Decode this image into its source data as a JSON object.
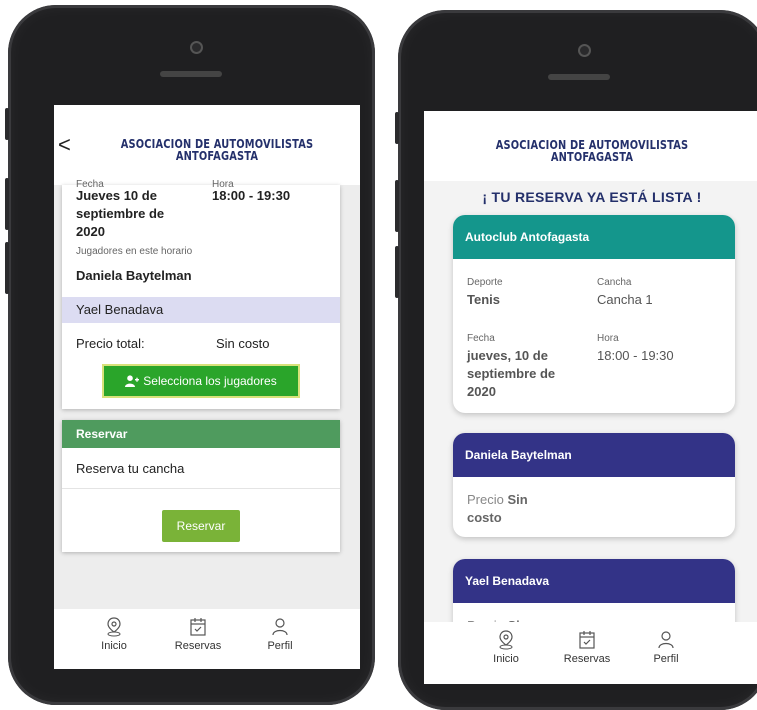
{
  "left": {
    "header": {
      "back_glyph": "<",
      "title_line1": "ASOCIACION  DE  AUTOMOVILISTAS",
      "title_line2": "ANTOFAGASTA"
    },
    "booking": {
      "date_label": "Fecha",
      "time_label": "Hora",
      "date_value": [
        "Jueves 10 de",
        "septiembre de",
        "2020"
      ],
      "time_value": "18:00 - 19:30",
      "players_label": "Jugadores en este horario",
      "player1": "Daniela Baytelman",
      "player2": "Yael Benadava",
      "price_label": "Precio total:",
      "price_value": "Sin costo",
      "select_players_button": "Selecciona los jugadores"
    },
    "reserve_card": {
      "header": "Reservar",
      "text": "Reserva tu cancha",
      "button": "Reservar"
    },
    "nav": [
      {
        "icon": "location-pin-icon",
        "label": "Inicio"
      },
      {
        "icon": "calendar-check-icon",
        "label": "Reservas"
      },
      {
        "icon": "user-icon",
        "label": "Perfil"
      }
    ]
  },
  "right": {
    "header": {
      "title_line1": "ASOCIACION  DE  AUTOMOVILISTAS",
      "title_line2": "ANTOFAGASTA"
    },
    "banner": "¡ TU RESERVA YA ESTÁ LISTA !",
    "club_card": {
      "header": "Autoclub Antofagasta",
      "sport_label": "Deporte",
      "sport_value": "Tenis",
      "court_label": "Cancha",
      "court_value": "Cancha 1",
      "date_label": "Fecha",
      "date_value": [
        "jueves, 10 de",
        "septiembre de",
        "2020"
      ],
      "time_label": "Hora",
      "time_value": "18:00 - 19:30"
    },
    "player_card1": {
      "header": "Daniela Baytelman",
      "price_prefix": "Precio",
      "price_bold1": "Sin",
      "price_bold2": "costo"
    },
    "player_card2": {
      "header": "Yael Benadava",
      "price_prefix": "Precio",
      "price_bold1": "Sin"
    },
    "nav": [
      {
        "icon": "location-pin-icon",
        "label": "Inicio"
      },
      {
        "icon": "calendar-check-icon",
        "label": "Reservas"
      },
      {
        "icon": "user-icon",
        "label": "Perfil"
      }
    ]
  },
  "colors": {
    "navy": "#24306b",
    "teal": "#14968c",
    "purple": "#333387",
    "green_header": "#4f9b5e",
    "green_button": "#2aa52a",
    "olive_button": "#7ab338",
    "lavender_row": "#dcdcf2"
  }
}
